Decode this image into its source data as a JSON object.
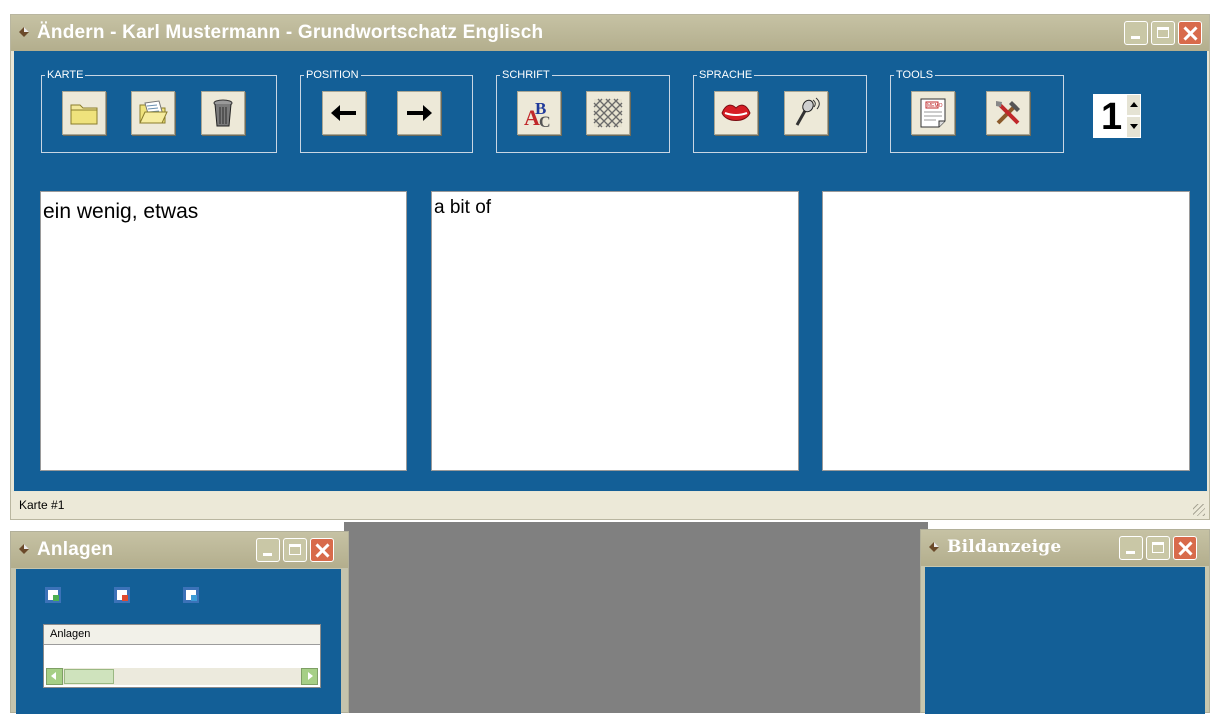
{
  "main_window": {
    "title": "Ändern - Karl Mustermann - Grundwortschatz Englisch",
    "status": "Karte #1"
  },
  "toolbar": {
    "groups": [
      {
        "label": "KARTE",
        "buttons": [
          "folder-icon",
          "open-folder-icon",
          "trash-icon"
        ]
      },
      {
        "label": "POSITION",
        "buttons": [
          "arrow-left-icon",
          "arrow-right-icon"
        ]
      },
      {
        "label": "SCHRIFT",
        "buttons": [
          "abc-font-icon",
          "pattern-icon"
        ]
      },
      {
        "label": "SPRACHE",
        "buttons": [
          "lips-icon",
          "microphone-icon"
        ]
      },
      {
        "label": "TOOLS",
        "buttons": [
          "memo-icon",
          "tools-icon"
        ]
      }
    ],
    "counter": "1"
  },
  "cards": {
    "german": "ein wenig, etwas",
    "english": "a bit of",
    "third": ""
  },
  "attachments_window": {
    "title": "Anlagen",
    "list_header": "Anlagen",
    "icons": [
      "add-attachment-icon",
      "remove-attachment-icon",
      "open-attachment-icon"
    ]
  },
  "image_window": {
    "title": "Bildanzeige"
  },
  "colors": {
    "panel_blue": "#135f97",
    "title_bar": "#bdb99b",
    "desktop_gray": "#808080",
    "close_red": "#d86b4b"
  }
}
